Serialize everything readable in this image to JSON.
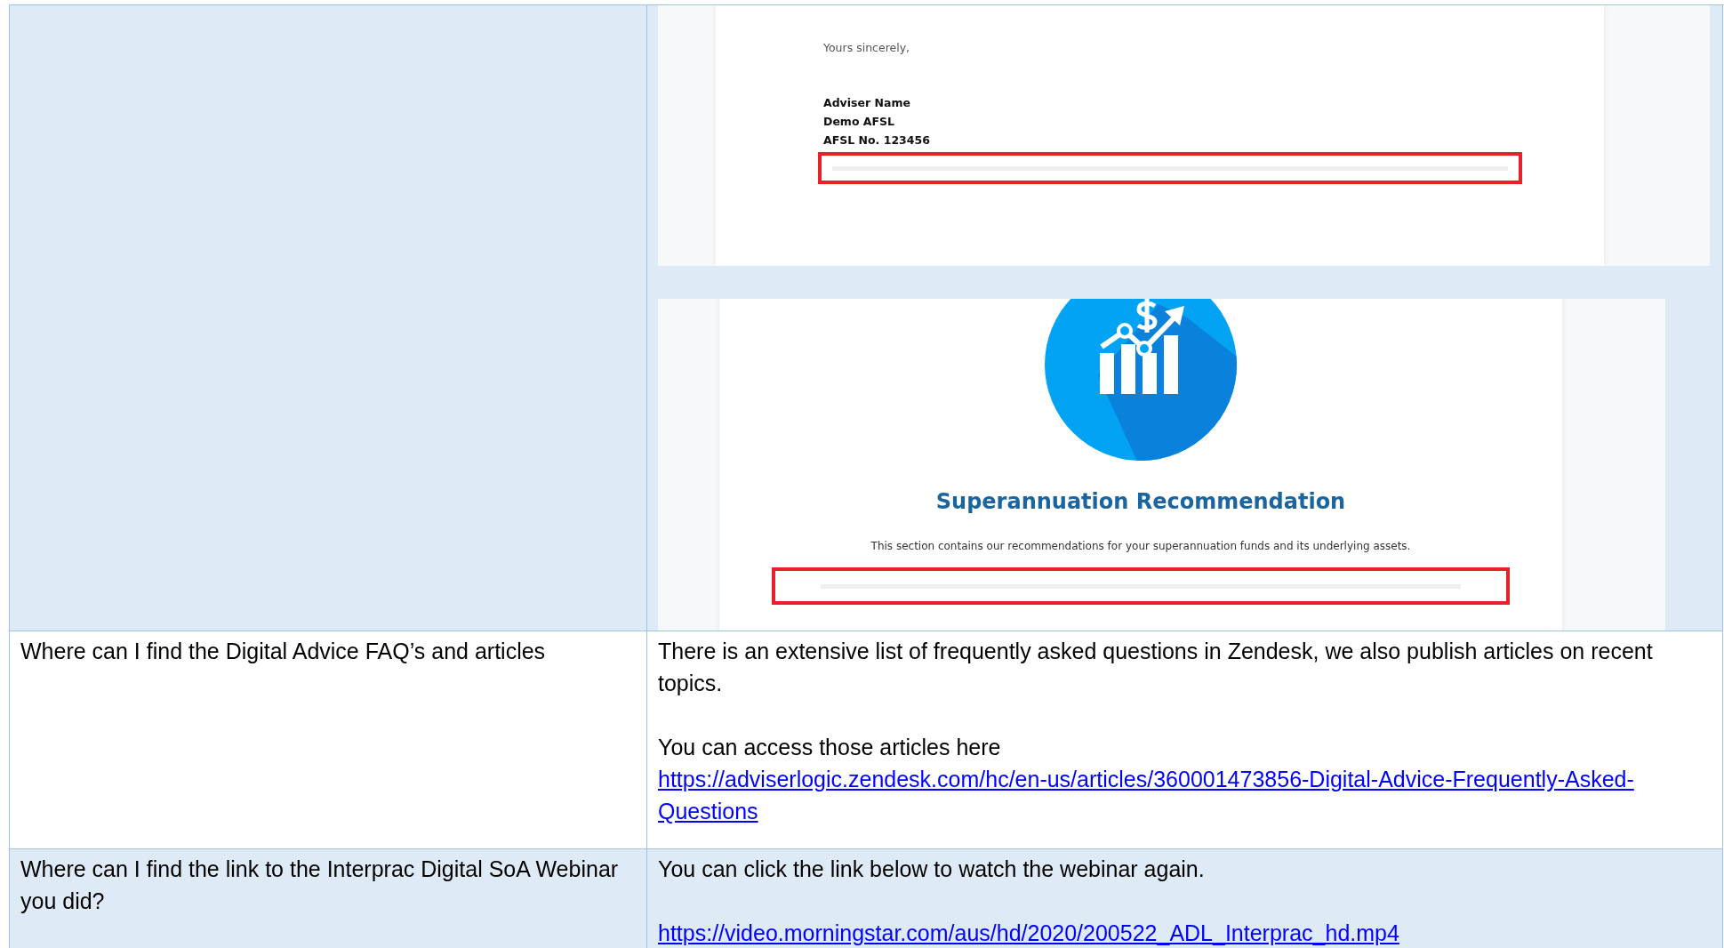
{
  "table": {
    "rows": [
      {
        "shaded": true,
        "answer": [
          {
            "kind": "letter_preview",
            "closing": "Yours sincerely,",
            "signature": [
              "Adviser Name",
              "Demo AFSL",
              "AFSL No. 123456"
            ]
          },
          {
            "kind": "section_preview",
            "title": "Superannuation Recommendation",
            "description": "This section contains our recommendations for your superannuation funds and its underlying assets."
          }
        ]
      },
      {
        "shaded": false,
        "question": "Where can I find the Digital Advice FAQ’s and articles",
        "answer": [
          {
            "kind": "text",
            "text": "There is an extensive list of frequently asked questions in Zendesk, we also publish articles on recent topics."
          },
          {
            "kind": "gap"
          },
          {
            "kind": "text",
            "text": "You can access those articles here"
          },
          {
            "kind": "link",
            "text": "https://adviserlogic.zendesk.com/hc/en-us/articles/360001473856-Digital-Advice-Frequently-Asked-Questions"
          }
        ]
      },
      {
        "shaded": true,
        "question": "Where can I find the link to the Interprac Digital SoA Webinar you did?",
        "answer": [
          {
            "kind": "text",
            "text": "You can click the link below to watch the webinar again."
          },
          {
            "kind": "gap"
          },
          {
            "kind": "link",
            "text": "https://video.morningstar.com/aus/hd/2020/200522_ADL_Interprac_hd.mp4"
          }
        ]
      }
    ]
  }
}
